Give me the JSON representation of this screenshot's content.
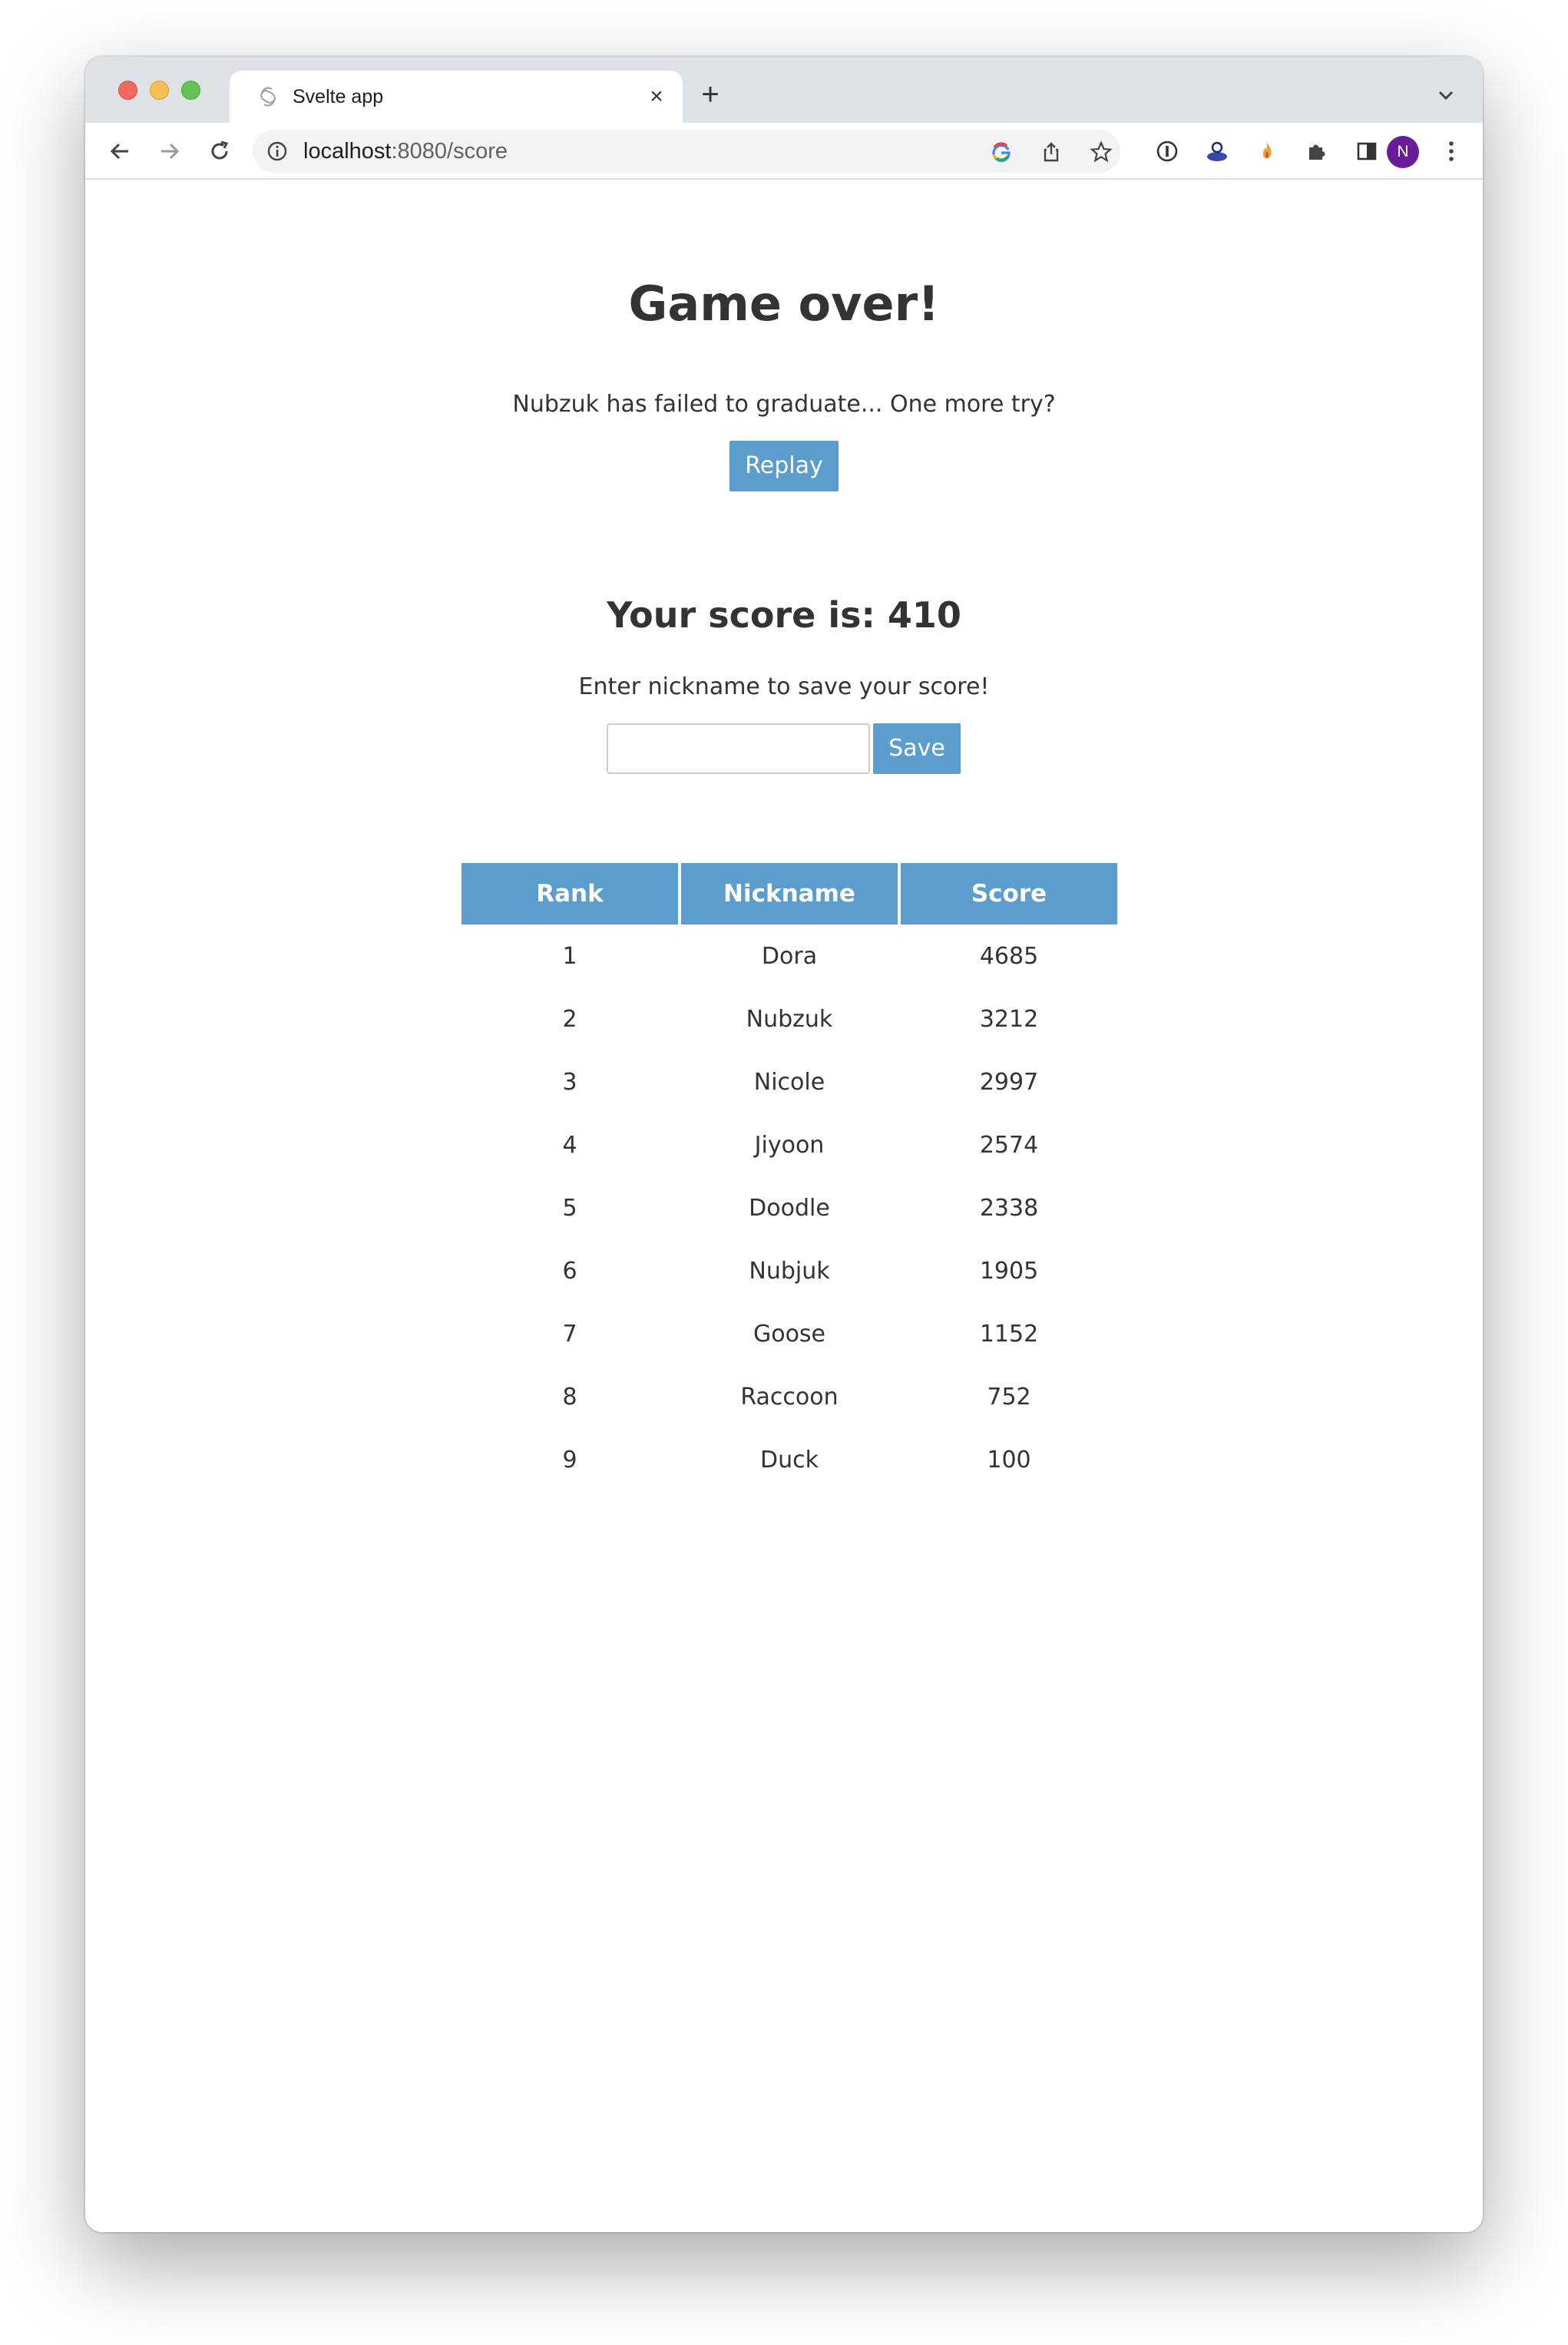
{
  "browser": {
    "tab_title": "Svelte app",
    "new_tab_symbol": "+",
    "close_symbol": "×",
    "url_host": "localhost",
    "url_path": ":8080/score",
    "avatar_initial": "N",
    "icons": [
      "back-icon",
      "forward-icon",
      "reload-icon",
      "site-info-icon",
      "google-lens-icon",
      "share-icon",
      "bookmark-star-icon",
      "extension-1password-icon",
      "extension-profile-icon",
      "extension-flame-icon",
      "extensions-puzzle-icon",
      "side-panel-icon",
      "menu-dots-icon"
    ]
  },
  "page": {
    "title": "Game over!",
    "message": "Nubzuk has failed to graduate... One more try?",
    "replay_label": "Replay",
    "score_heading": "Your score is: 410",
    "prompt": "Enter nickname to save your score!",
    "nickname_value": "",
    "save_label": "Save"
  },
  "leaderboard": {
    "columns": [
      "Rank",
      "Nickname",
      "Score"
    ],
    "rows": [
      {
        "rank": "1",
        "nickname": "Dora",
        "score": "4685"
      },
      {
        "rank": "2",
        "nickname": "Nubzuk",
        "score": "3212"
      },
      {
        "rank": "3",
        "nickname": "Nicole",
        "score": "2997"
      },
      {
        "rank": "4",
        "nickname": "Jiyoon",
        "score": "2574"
      },
      {
        "rank": "5",
        "nickname": "Doodle",
        "score": "2338"
      },
      {
        "rank": "6",
        "nickname": "Nubjuk",
        "score": "1905"
      },
      {
        "rank": "7",
        "nickname": "Goose",
        "score": "1152"
      },
      {
        "rank": "8",
        "nickname": "Raccoon",
        "score": "752"
      },
      {
        "rank": "9",
        "nickname": "Duck",
        "score": "100"
      }
    ]
  },
  "colors": {
    "accent": "#5b9dcd",
    "avatar": "#6a1b9a",
    "text": "#333333"
  }
}
